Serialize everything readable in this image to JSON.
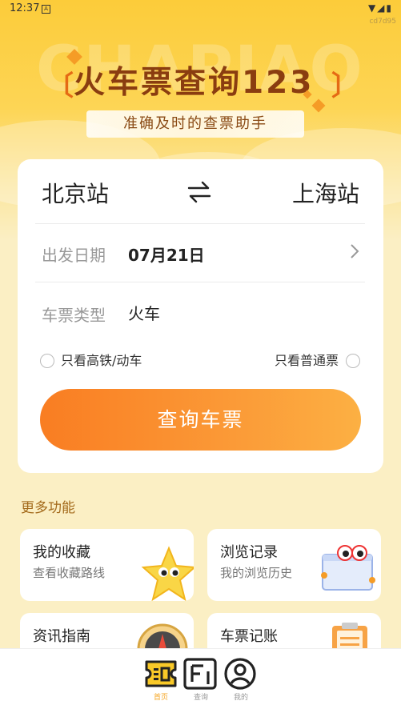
{
  "status_bar": {
    "time": "12:37",
    "small_icon": "A",
    "right_icons": "▼◢▮",
    "tag": "cd7d95"
  },
  "hero": {
    "watermark": "CHAPIAO",
    "title": "火车票查询123",
    "bracket_left": "〔",
    "bracket_right": "〕",
    "subtitle": "准确及时的查票助手"
  },
  "search": {
    "from_station": "北京站",
    "to_station": "上海站",
    "date_label": "出发日期",
    "date_value": "07月21日",
    "type_label": "车票类型",
    "type_value": "火车",
    "filter_high_speed": "只看高铁/动车",
    "filter_normal": "只看普通票",
    "search_button": "查询车票"
  },
  "more": {
    "section_title": "更多功能",
    "cards": [
      {
        "title": "我的收藏",
        "subtitle": "查看收藏路线",
        "icon": "star-mascot-icon"
      },
      {
        "title": "浏览记录",
        "subtitle": "我的浏览历史",
        "icon": "browser-window-icon"
      },
      {
        "title": "资讯指南",
        "subtitle": "",
        "icon": "compass-icon"
      },
      {
        "title": "车票记账",
        "subtitle": "",
        "icon": "clipboard-icon"
      }
    ]
  },
  "tabbar": {
    "tabs": [
      {
        "label": "首页",
        "icon": "ticket-icon",
        "active": true
      },
      {
        "label": "查询",
        "icon": "search-card-icon",
        "active": false
      },
      {
        "label": "我的",
        "icon": "user-icon",
        "active": false
      }
    ]
  },
  "colors": {
    "accent": "#f97d22",
    "hero_yellow": "#fccc3a",
    "title_brown": "#8a3d10",
    "section_gold": "#a3691a",
    "active_tab": "#f5a623"
  }
}
